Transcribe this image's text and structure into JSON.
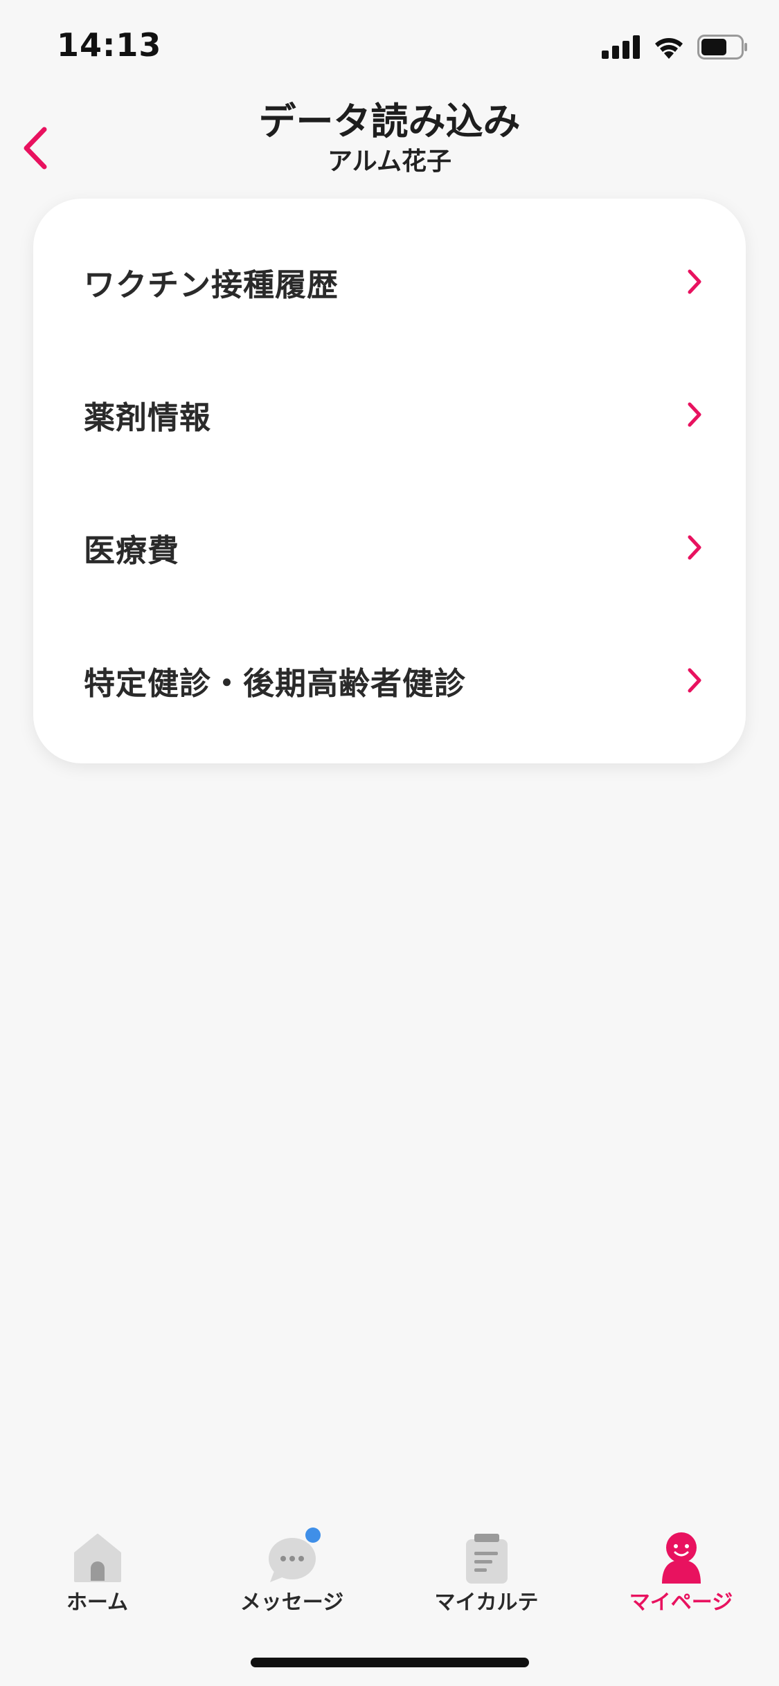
{
  "status_bar": {
    "time": "14:13"
  },
  "header": {
    "title": "データ読み込み",
    "subtitle": "アルム花子"
  },
  "menu": {
    "items": [
      {
        "label": "ワクチン接種履歴"
      },
      {
        "label": "薬剤情報"
      },
      {
        "label": "医療費"
      },
      {
        "label": "特定健診・後期高齢者健診"
      }
    ]
  },
  "tab_bar": {
    "tabs": [
      {
        "label": "ホーム",
        "icon": "home-icon"
      },
      {
        "label": "メッセージ",
        "icon": "message-icon"
      },
      {
        "label": "マイカルテ",
        "icon": "clipboard-icon"
      },
      {
        "label": "マイページ",
        "icon": "person-icon"
      }
    ],
    "active_index": 3
  },
  "colors": {
    "accent": "#e8125f",
    "badge": "#3f8fe8",
    "background": "#f7f7f7",
    "inactive_icon": "#d9d9d9"
  }
}
